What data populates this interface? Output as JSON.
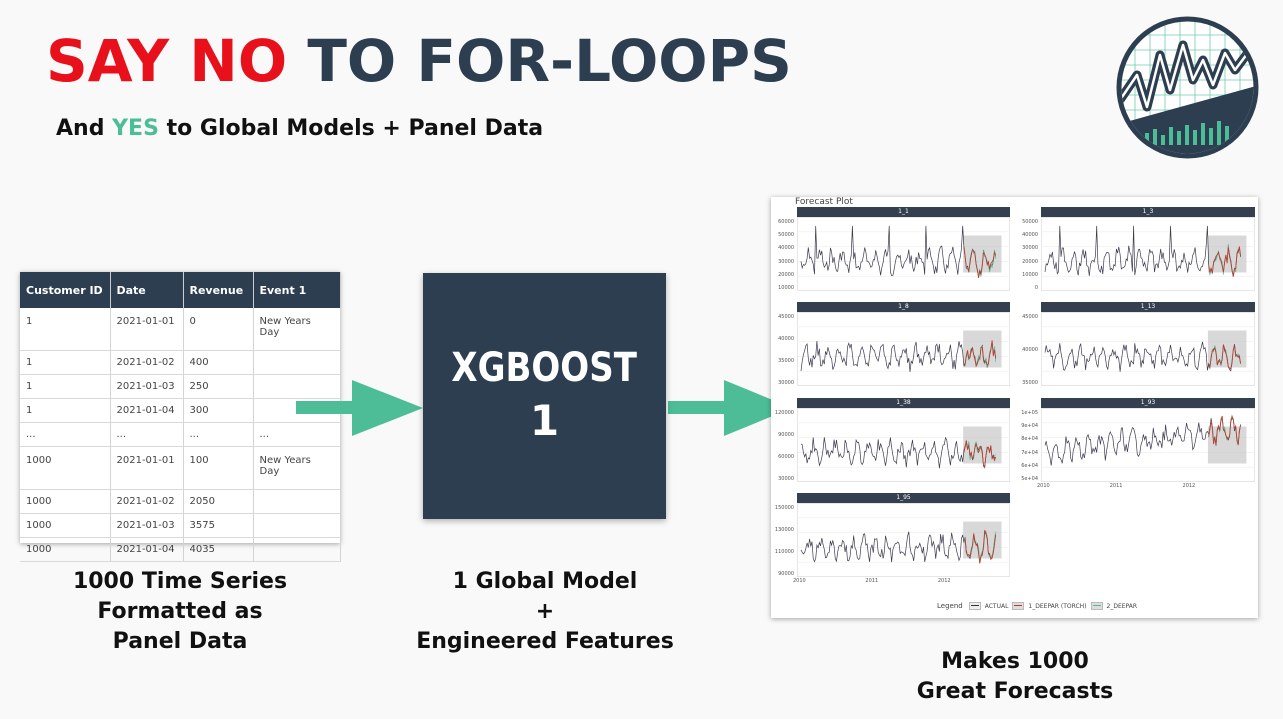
{
  "header": {
    "title_part1": "SAY NO",
    "title_part2": "TO FOR-LOOPS",
    "subtitle_pre": "And",
    "subtitle_highlight": "YES",
    "subtitle_post": "to Global Models + Panel Data"
  },
  "colors": {
    "red": "#e8101a",
    "navy": "#2c3e50",
    "green": "#4dbd98",
    "arrow": "#4dbd98"
  },
  "table": {
    "columns": [
      "Customer ID",
      "Date",
      "Revenue",
      "Event 1"
    ],
    "rows": [
      [
        "1",
        "2021-01-01",
        "0",
        "New Years Day"
      ],
      [
        "1",
        "2021-01-02",
        "400",
        ""
      ],
      [
        "1",
        "2021-01-03",
        "250",
        ""
      ],
      [
        "1",
        "2021-01-04",
        "300",
        ""
      ],
      [
        "...",
        "...",
        "...",
        "..."
      ],
      [
        "1000",
        "2021-01-01",
        "100",
        "New Years Day"
      ],
      [
        "1000",
        "2021-01-02",
        "2050",
        ""
      ],
      [
        "1000",
        "2021-01-03",
        "3575",
        ""
      ],
      [
        "1000",
        "2021-01-04",
        "4035",
        ""
      ]
    ]
  },
  "captions": {
    "left": [
      "1000 Time Series",
      "Formatted as",
      "Panel Data"
    ],
    "middle": [
      "1 Global Model",
      "+",
      "Engineered Features"
    ],
    "right": [
      "Makes 1000",
      "Great Forecasts"
    ]
  },
  "model_box": {
    "line1": "XGBOOST",
    "line2": "1"
  },
  "forecast_plot": {
    "title": "Forecast Plot",
    "facets": [
      {
        "label": "1_1",
        "yticks": [
          "60000",
          "50000",
          "40000",
          "30000",
          "20000",
          "10000"
        ]
      },
      {
        "label": "1_3",
        "yticks": [
          "50000",
          "40000",
          "30000",
          "20000",
          "10000",
          "0"
        ]
      },
      {
        "label": "1_8",
        "yticks": [
          "45000",
          "40000",
          "35000",
          "30000"
        ]
      },
      {
        "label": "1_13",
        "yticks": [
          "45000",
          "40000",
          "35000"
        ]
      },
      {
        "label": "1_38",
        "yticks": [
          "120000",
          "90000",
          "60000",
          "30000"
        ],
        "xticks": []
      },
      {
        "label": "1_93",
        "yticks": [
          "1e+05",
          "9e+04",
          "8e+04",
          "7e+04",
          "6e+04",
          "5e+04"
        ],
        "xticks": [
          "2010",
          "2011",
          "2012"
        ]
      },
      {
        "label": "1_95",
        "yticks": [
          "150000",
          "130000",
          "110000",
          "90000"
        ],
        "xticks": [
          "2010",
          "2011",
          "2012"
        ]
      }
    ],
    "legend": {
      "title": "Legend",
      "items": [
        "ACTUAL",
        "1_DEEPAR (TORCH)",
        "2_DEEPAR"
      ]
    }
  }
}
